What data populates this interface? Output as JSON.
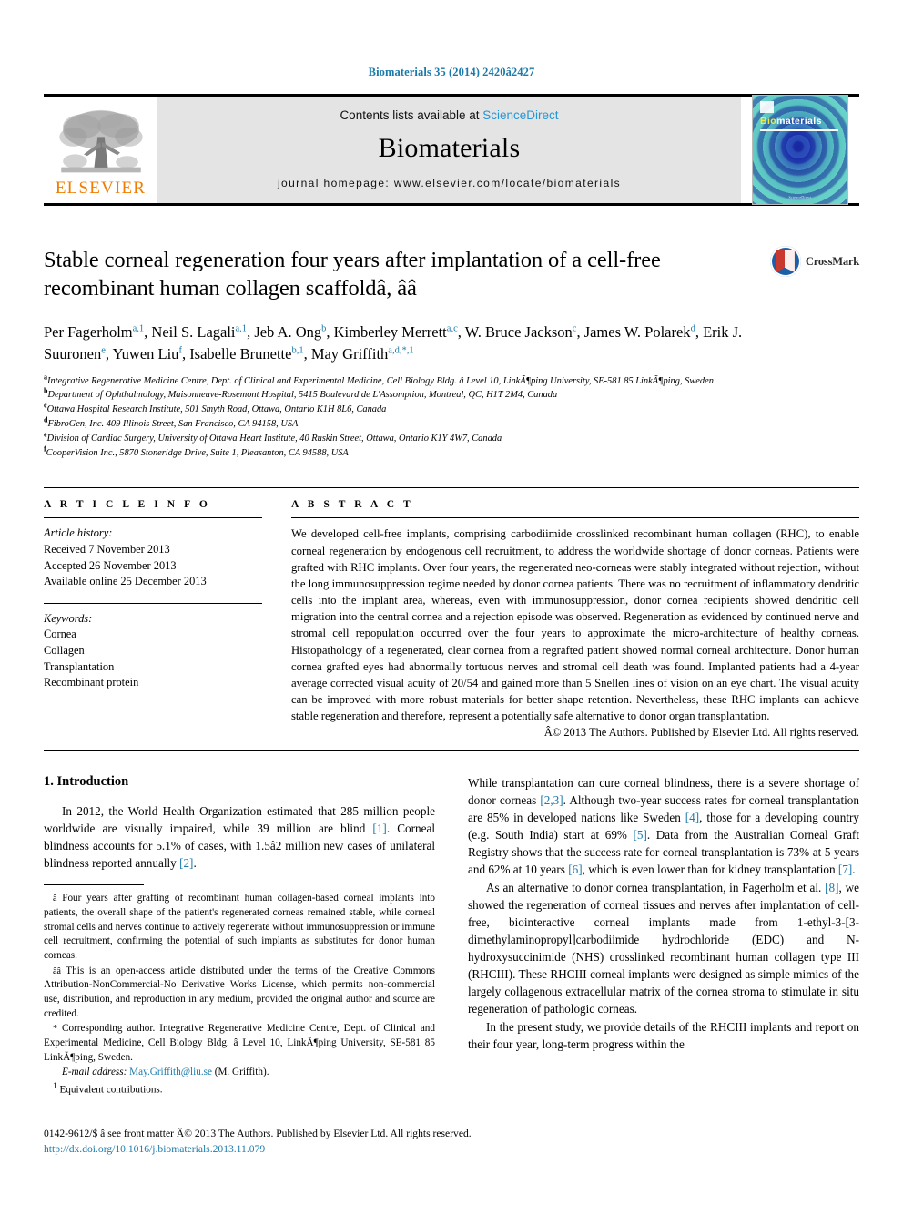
{
  "running_head": "Biomaterials 35 (2014) 2420â2427",
  "banner": {
    "publisher_name": "ELSEVIER",
    "contents_prefix": "Contents lists available at ",
    "contents_link": "ScienceDirect",
    "journal_name": "Biomaterials",
    "homepage": "journal homepage: www.elsevier.com/locate/biomaterials",
    "cover_title_first": "Bio",
    "cover_title_rest": "materials",
    "cover_footer": "ScienceDirect"
  },
  "title": "Stable corneal regeneration four years after implantation of a cell-free recombinant human collagen scaffoldâ, ââ",
  "crossmark_label": "CrossMark",
  "authors": [
    {
      "name": "Per Fagerholm",
      "sup": "a,1",
      "sep": ", "
    },
    {
      "name": "Neil S. Lagali",
      "sup": "a,1",
      "sep": ", "
    },
    {
      "name": "Jeb A. Ong",
      "sup": "b",
      "sep": ", "
    },
    {
      "name": "Kimberley Merrett",
      "sup": "a,c",
      "sep": ", "
    },
    {
      "name": "W. Bruce Jackson",
      "sup": "c",
      "sep": ", "
    },
    {
      "name": "James W. Polarek",
      "sup": "d",
      "sep": ", "
    },
    {
      "name": "Erik J. Suuronen",
      "sup": "e",
      "sep": ", "
    },
    {
      "name": "Yuwen Liu",
      "sup": "f",
      "sep": ", "
    },
    {
      "name": "Isabelle Brunette",
      "sup": "b,1",
      "sep": ", "
    },
    {
      "name": "May Griffith",
      "sup": "a,d,*,1",
      "sep": ""
    }
  ],
  "affiliations": [
    {
      "mark": "a",
      "text": "Integrative Regenerative Medicine Centre, Dept. of Clinical and Experimental Medicine, Cell Biology Bldg. â Level 10, LinkÃ¶ping University, SE-581 85 LinkÃ¶ping, Sweden"
    },
    {
      "mark": "b",
      "text": "Department of Ophthalmology, Maisonneuve-Rosemont Hospital, 5415 Boulevard de L'Assomption, Montreal, QC, H1T 2M4, Canada"
    },
    {
      "mark": "c",
      "text": "Ottawa Hospital Research Institute, 501 Smyth Road, Ottawa, Ontario K1H 8L6, Canada"
    },
    {
      "mark": "d",
      "text": "FibroGen, Inc. 409 Illinois Street, San Francisco, CA 94158, USA"
    },
    {
      "mark": "e",
      "text": "Division of Cardiac Surgery, University of Ottawa Heart Institute, 40 Ruskin Street, Ottawa, Ontario K1Y 4W7, Canada"
    },
    {
      "mark": "f",
      "text": "CooperVision Inc., 5870 Stoneridge Drive, Suite 1, Pleasanton, CA 94588, USA"
    }
  ],
  "article_info": {
    "heading": "A R T I C L E  I N F O",
    "history_label": "Article history:",
    "history": [
      "Received 7 November 2013",
      "Accepted 26 November 2013",
      "Available online 25 December 2013"
    ],
    "keywords_label": "Keywords:",
    "keywords": [
      "Cornea",
      "Collagen",
      "Transplantation",
      "Recombinant protein"
    ]
  },
  "abstract": {
    "heading": "A B S T R A C T",
    "text": "We developed cell-free implants, comprising carbodiimide crosslinked recombinant human collagen (RHC), to enable corneal regeneration by endogenous cell recruitment, to address the worldwide shortage of donor corneas. Patients were grafted with RHC implants. Over four years, the regenerated neo-corneas were stably integrated without rejection, without the long immunosuppression regime needed by donor cornea patients. There was no recruitment of inflammatory dendritic cells into the implant area, whereas, even with immunosuppression, donor cornea recipients showed dendritic cell migration into the central cornea and a rejection episode was observed. Regeneration as evidenced by continued nerve and stromal cell repopulation occurred over the four years to approximate the micro-architecture of healthy corneas. Histopathology of a regenerated, clear cornea from a regrafted patient showed normal corneal architecture. Donor human cornea grafted eyes had abnormally tortuous nerves and stromal cell death was found. Implanted patients had a 4-year average corrected visual acuity of 20/54 and gained more than 5 Snellen lines of vision on an eye chart. The visual acuity can be improved with more robust materials for better shape retention. Nevertheless, these RHC implants can achieve stable regeneration and therefore, represent a potentially safe alternative to donor organ transplantation.",
    "copyright": "Â© 2013 The Authors. Published by Elsevier Ltd. All rights reserved."
  },
  "body": {
    "section_number_title": "1.  Introduction",
    "left_para_1_a": "In 2012, the World Health Organization estimated that 285 million people worldwide are visually impaired, while 39 million are blind ",
    "left_para_1_ref1": "[1]",
    "left_para_1_b": ". Corneal blindness accounts for 5.1% of cases, with 1.5â2 million new cases of unilateral blindness reported annually ",
    "left_para_1_ref2": "[2]",
    "left_para_1_c": ".",
    "right_para_1_a": "While transplantation can cure corneal blindness, there is a severe shortage of donor corneas ",
    "right_para_1_ref1": "[2,3]",
    "right_para_1_b": ". Although two-year success rates for corneal transplantation are 85% in developed nations like Sweden ",
    "right_para_1_ref2": "[4]",
    "right_para_1_c": ", those for a developing country (e.g. South India) start at 69% ",
    "right_para_1_ref3": "[5]",
    "right_para_1_d": ". Data from the Australian Corneal Graft Registry shows that the success rate for corneal transplantation is 73% at 5 years and 62% at 10 years ",
    "right_para_1_ref4": "[6]",
    "right_para_1_e": ", which is even lower than for kidney transplantation ",
    "right_para_1_ref5": "[7]",
    "right_para_1_f": ".",
    "right_para_2_a": "As an alternative to donor cornea transplantation, in Fagerholm et al. ",
    "right_para_2_ref1": "[8]",
    "right_para_2_b": ", we showed the regeneration of corneal tissues and nerves after implantation of cell-free, biointeractive corneal implants made from 1-ethyl-3-[3-dimethylaminopropyl]carbodiimide hydrochloride (EDC) and N-hydroxysuccinimide (NHS) crosslinked recombinant human collagen type III (RHCIII). These RHCIII corneal implants were designed as simple mimics of the largely collagenous extracellular matrix of the cornea stroma to stimulate in situ regeneration of pathologic corneas.",
    "right_para_3": "In the present study, we provide details of the RHCIII implants and report on their four year, long-term progress within the"
  },
  "footnotes": {
    "star_mark": "â",
    "star_text": "Four years after grafting of recombinant human collagen-based corneal implants into patients, the overall shape of the patient's regenerated corneas remained stable, while corneal stromal cells and nerves continue to actively regenerate without immunosuppression or immune cell recruitment, confirming the potential of such implants as substitutes for donor human corneas.",
    "starstar_mark": "ââ",
    "starstar_text": "This is an open-access article distributed under the terms of the Creative Commons Attribution-NonCommercial-No Derivative Works License, which permits non-commercial use, distribution, and reproduction in any medium, provided the original author and source are credited.",
    "corr_mark": "*",
    "corr_text": "Corresponding author. Integrative Regenerative Medicine Centre, Dept. of Clinical and Experimental Medicine, Cell Biology Bldg. â Level 10, LinkÃ¶ping University, SE-581 85 LinkÃ¶ping, Sweden.",
    "email_label": "E-mail address:",
    "email": "May.Griffith@liu.se",
    "email_suffix": " (M. Griffith).",
    "eq_mark": "1",
    "eq_text": "Equivalent contributions."
  },
  "page_footer": {
    "line1": "0142-9612/$ â see front matter Â© 2013 The Authors. Published by Elsevier Ltd. All rights reserved.",
    "doi": "http://dx.doi.org/10.1016/j.biomaterials.2013.11.079"
  },
  "colors": {
    "link_blue": "#1a7aab",
    "science_direct_blue": "#2596d4",
    "elsevier_orange": "#F07D00",
    "banner_gray": "#e4e4e4"
  }
}
